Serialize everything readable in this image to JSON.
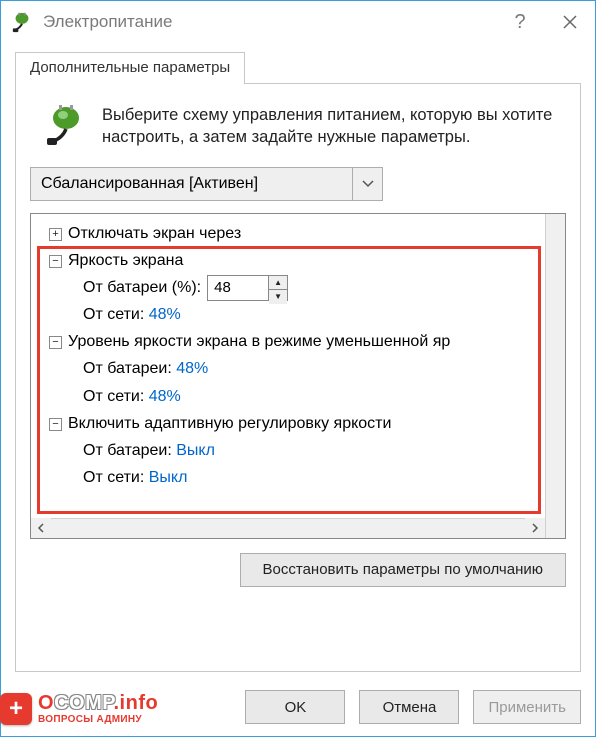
{
  "window": {
    "title": "Электропитание",
    "help": "?",
    "close": "×"
  },
  "tab": {
    "label": "Дополнительные параметры"
  },
  "intro": {
    "text": "Выберите схему управления питанием, которую вы хотите настроить, а затем задайте нужные параметры."
  },
  "scheme": {
    "selected": "Сбалансированная [Активен]"
  },
  "tree": {
    "nodes": [
      {
        "id": "n0",
        "level": 0,
        "expand": "plus",
        "label": "Отключать экран через"
      },
      {
        "id": "n1",
        "level": 0,
        "expand": "minus",
        "label": "Яркость экрана"
      },
      {
        "id": "n1a",
        "level": 1,
        "label": "От батареи (%):",
        "value_input": "48"
      },
      {
        "id": "n1b",
        "level": 1,
        "label": "От сети:",
        "value_link": "48%"
      },
      {
        "id": "n2",
        "level": 0,
        "expand": "minus",
        "label": "Уровень яркости экрана в режиме уменьшенной яр"
      },
      {
        "id": "n2a",
        "level": 1,
        "label": "От батареи:",
        "value_link": "48%"
      },
      {
        "id": "n2b",
        "level": 1,
        "label": "От сети:",
        "value_link": "48%"
      },
      {
        "id": "n3",
        "level": 0,
        "expand": "minus",
        "label": "Включить адаптивную регулировку яркости"
      },
      {
        "id": "n3a",
        "level": 1,
        "label": "От батареи:",
        "value_link": "Выкл"
      },
      {
        "id": "n3b",
        "level": 1,
        "label": "От сети:",
        "value_link": "Выкл"
      }
    ]
  },
  "buttons": {
    "restore": "Восстановить параметры по умолчанию",
    "ok": "OK",
    "cancel": "Отмена",
    "apply": "Применить"
  },
  "badge": {
    "line1a": "O",
    "line1b": "COMP",
    "line1c": ".info",
    "line2": "ВОПРОСЫ АДМИНУ"
  }
}
